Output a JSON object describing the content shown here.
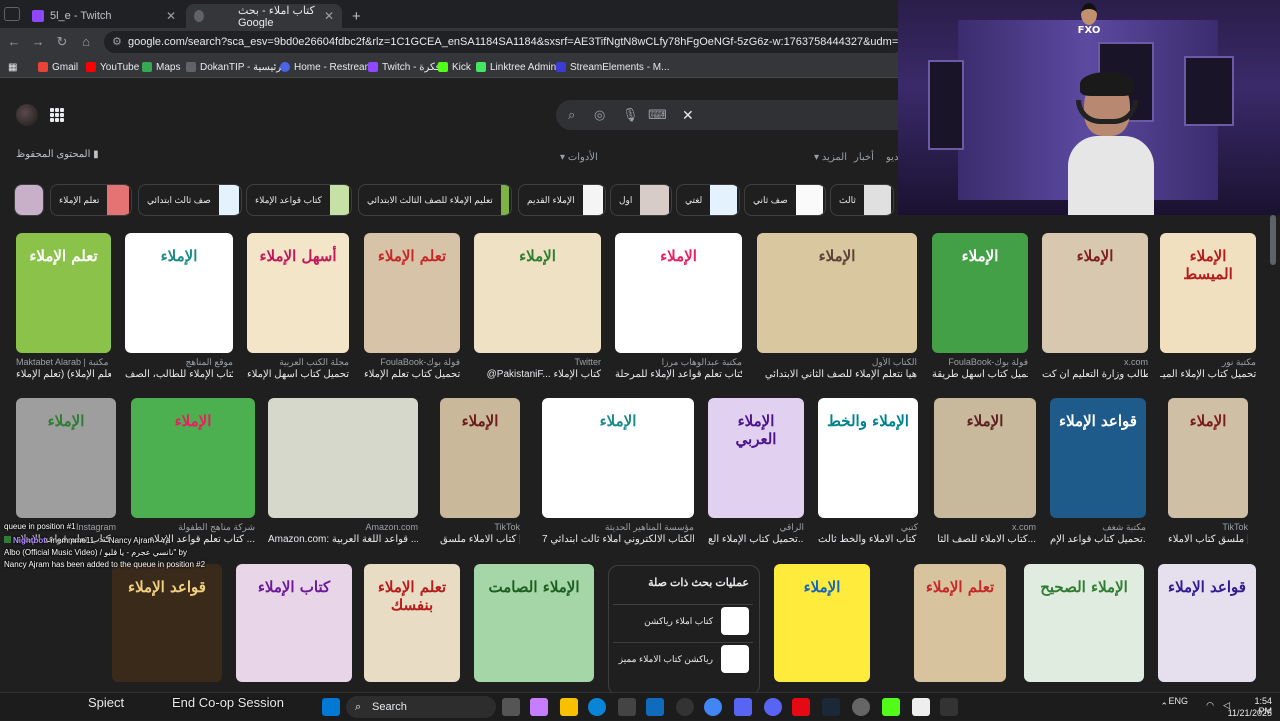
{
  "tabs": [
    {
      "label": "5l_e - Twitch",
      "favicon_color": "#9146ff"
    },
    {
      "label": "كتاب املاء - بحث Google",
      "favicon_color": "#5f6368"
    }
  ],
  "toolbar": {
    "url": "google.com/search?sca_esv=9bd0e26604fdbc2f&rlz=1C1GCEA_enSA1184SA1184&sxsrf=AE3TifNgtN8wCLfy78hFgOeNGf-5zG6z-w:1763758444327&udm=2&fbs=AIljpHya8RJaG7GTqOVD"
  },
  "bookmarks": [
    {
      "label": "Gmail",
      "color": "#ea4335"
    },
    {
      "label": "YouTube",
      "color": "#ff0000"
    },
    {
      "label": "Maps",
      "color": "#34a853"
    },
    {
      "label": "DokanTIP - الرئيسية",
      "color": "#5f6368"
    },
    {
      "label": "Home - Restream",
      "color": "#4a63e7"
    },
    {
      "label": "Twitch - فكرة",
      "color": "#9146ff"
    },
    {
      "label": "Kick",
      "color": "#53fc18"
    },
    {
      "label": "Linktree Admin",
      "color": "#43e660"
    },
    {
      "label": "StreamElements - M...",
      "color": "#3b3bd6"
    }
  ],
  "google": {
    "saved_label": "المحتوى المحفوظ",
    "tools_label": "الأدوات",
    "more_label": "المزيد",
    "news_label": "أخبار",
    "videos_label": "فيديو"
  },
  "chips": [
    {
      "label": "تعلم الإملاء"
    },
    {
      "label": "صف ثالث ابتدائي"
    },
    {
      "label": "كتاب قواعد الإملاء"
    },
    {
      "label": "تعليم الإملاء للصف الثالث الابتدائي"
    },
    {
      "label": "الإملاء القديم"
    },
    {
      "label": "اول"
    },
    {
      "label": "لغتي"
    },
    {
      "label": "صف ثاني"
    },
    {
      "label": "ثالث"
    }
  ],
  "row1": [
    {
      "source": "Maktabet Alarab | مكتبة ...",
      "caption": "سلسلة (تعلّم الإملاء) (تعلم الإملاء ...",
      "title": "تعلم الإملاء",
      "bg": "#8bc34a",
      "fg": "#ffffff"
    },
    {
      "source": "موقع المناهج",
      "caption": "كتاب الإملاء للطالب، الصف ...",
      "title": "الإملاء",
      "bg": "#ffffff",
      "fg": "#1a8a8a"
    },
    {
      "source": "مجلة الكتب العربية",
      "caption": "تحميل كتاب أسهل الإملاء ...",
      "title": "أسهل الإملاء",
      "bg": "#f3e5c8",
      "fg": "#c2185b"
    },
    {
      "source": "FoulaBook-فولة بوك",
      "caption": "تحميل كتاب تعلم الإملاء ...",
      "title": "تعلم الإملاء",
      "bg": "#d7c4a8",
      "fg": "#c62828"
    },
    {
      "source": "Twitter",
      "caption": "@PakistaniF... كتاب الإملاء",
      "title": "الإملاء",
      "bg": "#efe2c4",
      "fg": "#2e7d32"
    },
    {
      "source": "مكتبة عبدالوهاب مرزا",
      "caption": "كتاب تعلم قواعد الإملاء للمرحلة ...",
      "title": "الإملاء",
      "bg": "#ffffff",
      "fg": "#e91e63"
    },
    {
      "source": "الكتاب الأول",
      "caption": "هيا نتعلم الإملاء للصف الثاني الابتدائي",
      "title": "الإملاء",
      "bg": "#d9c7a0",
      "fg": "#5d4037"
    },
    {
      "source": "FoulaBook-فولة بوك",
      "caption": "تحميل كتاب أسهل طريقة ...",
      "title": "الإملاء",
      "bg": "#43a047",
      "fg": "#ffffff"
    },
    {
      "source": "x.com",
      "caption": "أطالب وزارة التعليم ان كت...",
      "title": "الإملاء",
      "bg": "#d8c8b0",
      "fg": "#7b1f1f"
    },
    {
      "source": "مكتبة نور",
      "caption": "تحميل كتاب الإملاء الميـ...",
      "title": "الإملاء الميسط",
      "bg": "#f0e0c0",
      "fg": "#b71c1c"
    }
  ],
  "row2": [
    {
      "source": "Instagram",
      "caption": "كتاب تعلم قواعد الإملاء ...",
      "title": "الإملاء",
      "bg": "#9e9e9e",
      "fg": "#2e7d32"
    },
    {
      "source": "شركة مناهج الطفولة",
      "caption": "كتاب تعلم قواعد الإملاء ...",
      "title": "الإملاء",
      "bg": "#4caf50",
      "fg": "#e91e63"
    },
    {
      "source": "Amazon.com",
      "caption": "Amazon.com: قواعد اللغة العربية ...",
      "title": "",
      "bg": "#d6d8cc",
      "fg": "#555555"
    },
    {
      "source": "TikTok",
      "caption": "كتاب الاملاء ملسق | ...",
      "title": "الإملاء",
      "bg": "#c9b89a",
      "fg": "#6d1b1b"
    },
    {
      "source": "مؤسسة المناهير الحديثة",
      "caption": "الكتاب الالكتروني املاء ثالث ابتدائي 7...",
      "title": "الإملاء",
      "bg": "#ffffff",
      "fg": "#1a8a8a"
    },
    {
      "source": "الراقي",
      "caption": "تحميل كتاب الإملاء الع...",
      "title": "الإملاء العربي",
      "bg": "#e1d0f0",
      "fg": "#4a148c"
    },
    {
      "source": "كتبي",
      "caption": "كتاب الاملاء والخط ثالث ...",
      "title": "الإملاء والخط",
      "bg": "#ffffff",
      "fg": "#00838f"
    },
    {
      "source": "x.com",
      "caption": "كتاب الاملاء للصف الثا...",
      "title": "الإملاء",
      "bg": "#c8b89c",
      "fg": "#5d1f1f"
    },
    {
      "source": "مكتبة شغف",
      "caption": "تحميل كتاب قواعد الإم...",
      "title": "قواعد الإملاء",
      "bg": "#1e5a8a",
      "fg": "#ffffff"
    },
    {
      "source": "TikTok",
      "caption": "ملسق كتاب الاملاء | ...",
      "title": "الإملاء",
      "bg": "#cfbfa5",
      "fg": "#7a1c1c"
    }
  ],
  "row3": [
    {
      "title": "قواعد الإملاء",
      "bg": "#3a2a1a",
      "fg": "#f0d080"
    },
    {
      "title": "كتاب الإملاء",
      "bg": "#e8d6e8",
      "fg": "#6a1b9a"
    },
    {
      "title": "تعلم الإملاء بنفسك",
      "bg": "#e8dcc4",
      "fg": "#b71c1c"
    },
    {
      "title": "الإملاء الصامت",
      "bg": "#a5d6a7",
      "fg": "#1b5e20"
    },
    {
      "title": "الإملاء",
      "bg": "#ffeb3b",
      "fg": "#1565c0"
    },
    {
      "title": "تعلم الإملاء",
      "bg": "#d7c39d",
      "fg": "#c62828"
    },
    {
      "title": "الإملاء الصحيح",
      "bg": "#e0ece0",
      "fg": "#2e7d32"
    },
    {
      "title": "قواعد الإملاء",
      "bg": "#e6e0ee",
      "fg": "#311b92"
    }
  ],
  "related": {
    "heading": "عمليات بحث ذات صلة",
    "items": [
      {
        "label": "كتاب املاء رياكشن"
      },
      {
        "label": "رياكشن كتاب الاملاء مميز"
      }
    ]
  },
  "webcam": {
    "logo_text": "FXO"
  },
  "chat": [
    {
      "text": "queue in position #1"
    },
    {
      "user": "Nightbot",
      "text": "memmme11 -> \"Nancy Ajram - Ya"
    },
    {
      "text": "Albo (Official Music Video) / نانسي عجرم - يا قلبو\" by"
    },
    {
      "text": "Nancy Ajram has been added to the queue in position #2"
    }
  ],
  "taskbar": {
    "search_label": "Search",
    "overlay_label": "End Co-op Session",
    "overlay_prefix": "Spiect",
    "lang": "ENG",
    "time": "1:54 PM",
    "date": "11/21/2025"
  }
}
